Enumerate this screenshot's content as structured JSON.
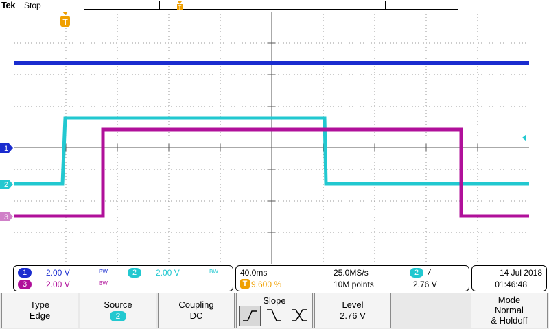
{
  "header": {
    "brand": "Tek",
    "run_state": "Stop"
  },
  "channels": {
    "ch1": {
      "label": "1",
      "color": "#1a2ccf",
      "scale": "2.00 V",
      "bw": "BW"
    },
    "ch2": {
      "label": "2",
      "color": "#22c8d0",
      "scale": "2.00 V",
      "bw": "BW"
    },
    "ch3": {
      "label": "3",
      "color": "#b0109a",
      "scale": "2.00 V",
      "bw": "BW"
    }
  },
  "timebase": {
    "horizontal_scale": "40.0ms",
    "sample_rate": "25.0MS/s",
    "trigger_position": "9.600 %",
    "record_length": "10M points",
    "trigger_source_label": "2",
    "trigger_slope_symbol": "/",
    "trigger_level": "2.76 V"
  },
  "datetime": {
    "date": "14 Jul 2018",
    "time": "01:46:48"
  },
  "menu": {
    "type": {
      "title": "Type",
      "value": "Edge"
    },
    "source": {
      "title": "Source",
      "value": "2"
    },
    "coupling": {
      "title": "Coupling",
      "value": "DC"
    },
    "slope": {
      "title": "Slope",
      "value": "rising"
    },
    "level": {
      "title": "Level",
      "value": "2.76 V"
    },
    "mode": {
      "title": "Mode",
      "value_line1": "Normal",
      "value_line2": "& Holdoff"
    }
  },
  "icons": {
    "trigger_marker": "trigger-t-icon",
    "trigger_level_arrow": "arrow-left-icon",
    "slope_rising": "rising-edge-icon",
    "slope_falling": "falling-edge-icon",
    "slope_either": "either-edge-icon"
  },
  "trigger_marker_color": "#f0a000"
}
